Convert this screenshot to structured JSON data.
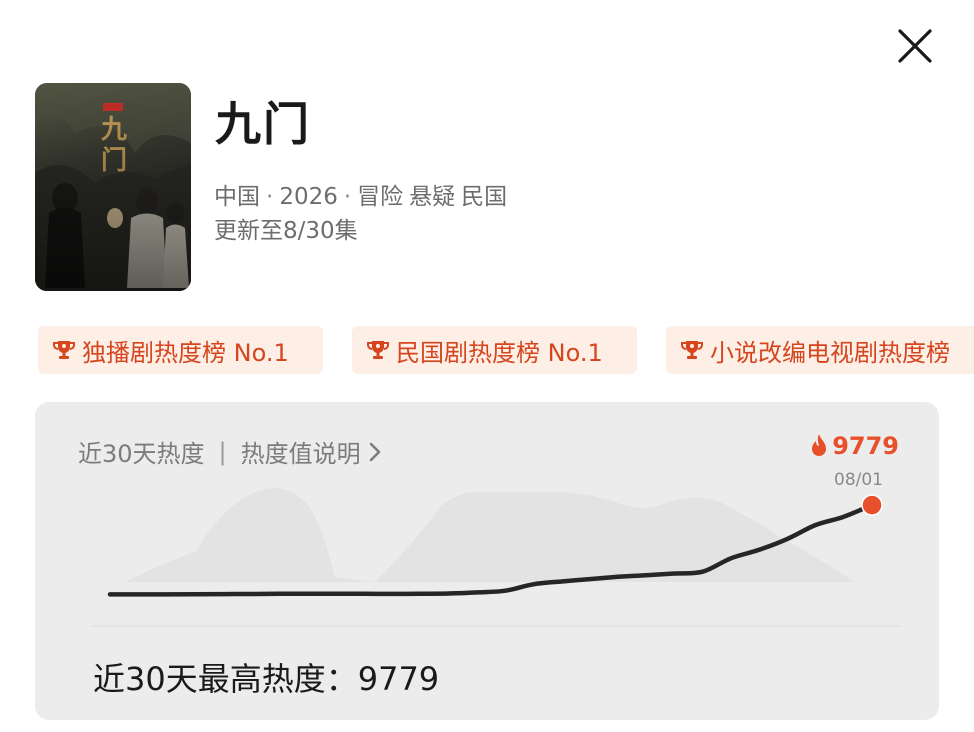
{
  "show": {
    "title": "九门",
    "country": "中国",
    "year": "2026",
    "genres": [
      "冒险",
      "悬疑",
      "民国"
    ],
    "update_status": "更新至8/30集"
  },
  "badges": [
    {
      "label": "独播剧热度榜 No.1",
      "icon": "trophy-icon"
    },
    {
      "label": "民国剧热度榜 No.1",
      "icon": "trophy-icon"
    },
    {
      "label": "小说改编电视剧热度榜",
      "icon": "trophy-icon"
    }
  ],
  "heat_card": {
    "title": "近30天热度",
    "separator": "|",
    "help_link": "热度值说明",
    "peak_value": "9779",
    "peak_date": "08/01",
    "summary": "近30天最高热度：9779"
  },
  "colors": {
    "accent": "#e8502b",
    "badge_bg": "#fdeee6",
    "badge_text": "#d5461f",
    "card_bg": "#ececec",
    "line": "#262626"
  },
  "chart_data": {
    "type": "line",
    "title": "近30天热度",
    "xlabel": "",
    "ylabel": "",
    "grid": false,
    "series": [
      {
        "values": [
          4950,
          4949,
          4950,
          4955,
          4965,
          4975,
          4985,
          4990,
          4990,
          4985,
          4980,
          4985,
          5000,
          5060,
          5150,
          5500,
          5650,
          5780,
          5900,
          5990,
          6080,
          6180,
          6900,
          7360,
          7950,
          8700,
          9150,
          9779
        ]
      }
    ],
    "highlight": {
      "label": "08/01",
      "value": 9779
    }
  }
}
